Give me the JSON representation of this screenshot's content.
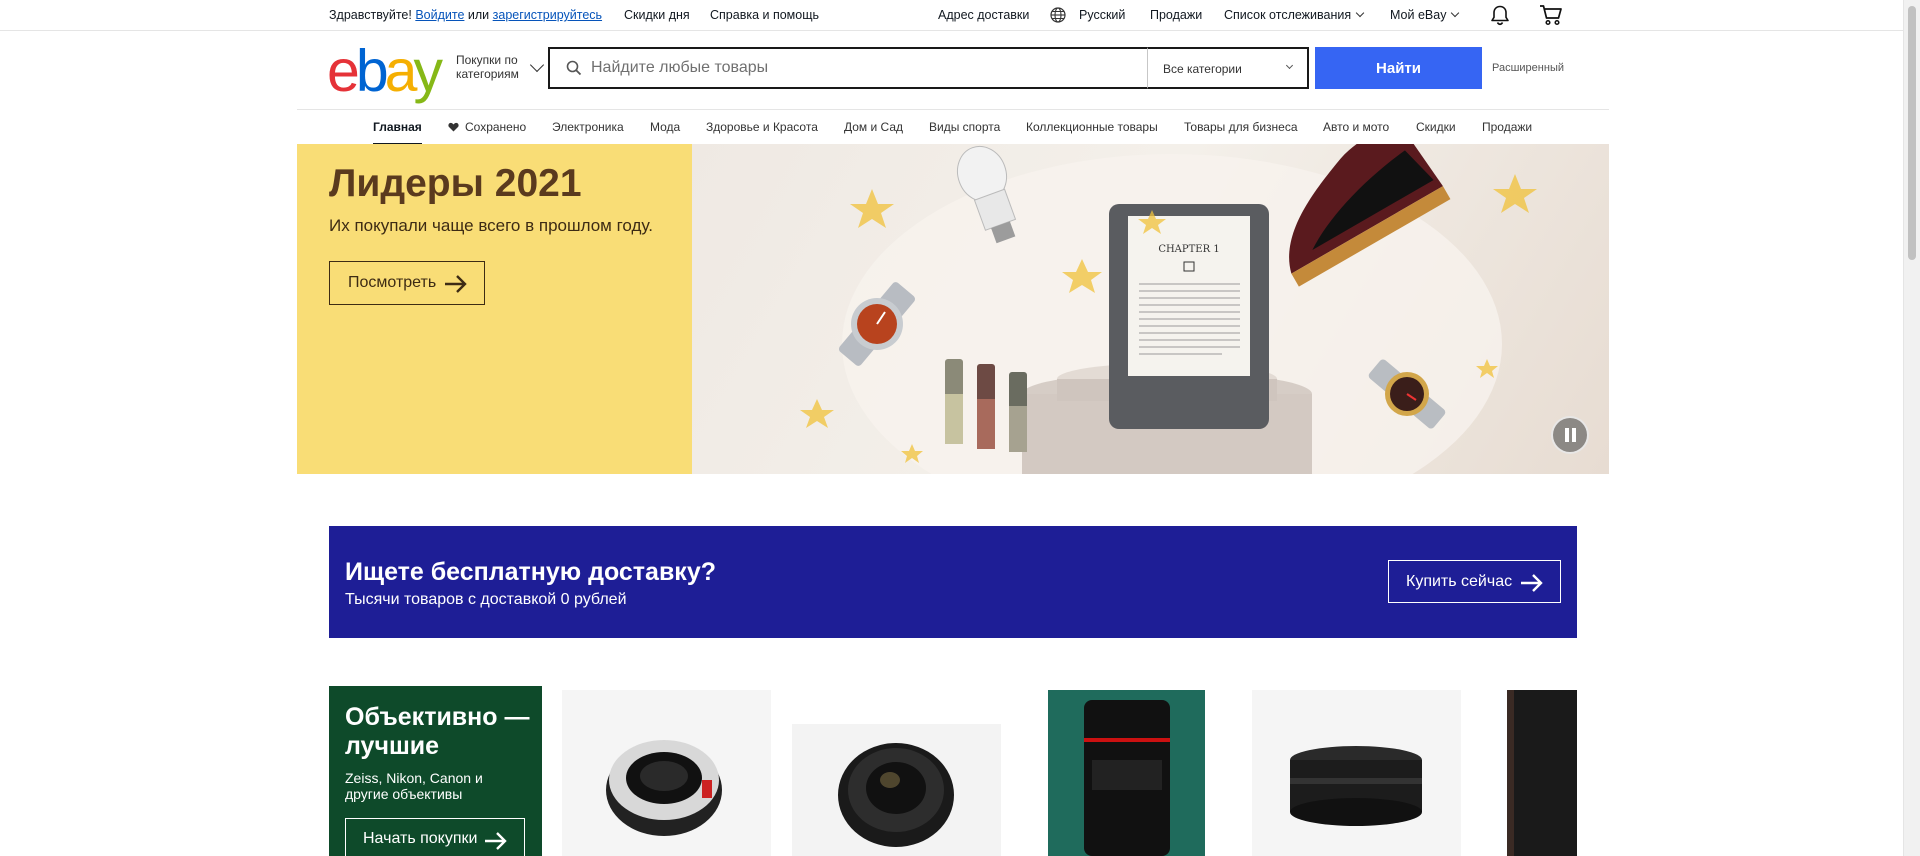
{
  "topbar": {
    "greeting": "Здравствуйте!",
    "signin": "Войдите",
    "or": "или",
    "register": "зарегистрируйтесь",
    "deals": "Скидки дня",
    "help": "Справка и помощь",
    "ship_to": "Адрес доставки",
    "language": "Русский",
    "sell": "Продажи",
    "watchlist": "Список отслеживания",
    "my_ebay": "Мой eBay"
  },
  "header": {
    "logo": [
      "e",
      "b",
      "a",
      "y"
    ],
    "shop_by_category": "Покупки по категориям",
    "search_placeholder": "Найдите любые товары",
    "category_select": "Все категории",
    "search_button": "Найти",
    "advanced": "Расширенный"
  },
  "nav": {
    "items": [
      "Главная",
      "Сохранено",
      "Электроника",
      "Мода",
      "Здоровье и Красота",
      "Дом и Сад",
      "Виды спорта",
      "Коллекционные товары",
      "Товары для бизнеса",
      "Авто и мото",
      "Скидки",
      "Продажи"
    ]
  },
  "hero": {
    "title": "Лидеры 2021",
    "subtitle": "Их покупали чаще всего в прошлом году.",
    "button": "Посмотреть",
    "book_heading": "CHAPTER 1"
  },
  "shipping_banner": {
    "title": "Ищете бесплатную доставку?",
    "subtitle": "Тысячи товаров с доставкой 0 рублей",
    "button": "Купить сейчас"
  },
  "lens_section": {
    "title": "Объективно — лучшие",
    "subtitle": "Zeiss, Nikon, Canon и другие объективы",
    "button": "Начать покупки"
  },
  "colors": {
    "search_button": "#3665f3",
    "hero_bg": "#f9dd76",
    "shipping_bg": "#1e1e96",
    "lens_bg": "#0e4a2a",
    "link": "#0654ba"
  },
  "icons": [
    "globe-icon",
    "bell-icon",
    "cart-icon",
    "search-icon",
    "heart-icon",
    "arrow-right-icon",
    "pause-icon"
  ]
}
